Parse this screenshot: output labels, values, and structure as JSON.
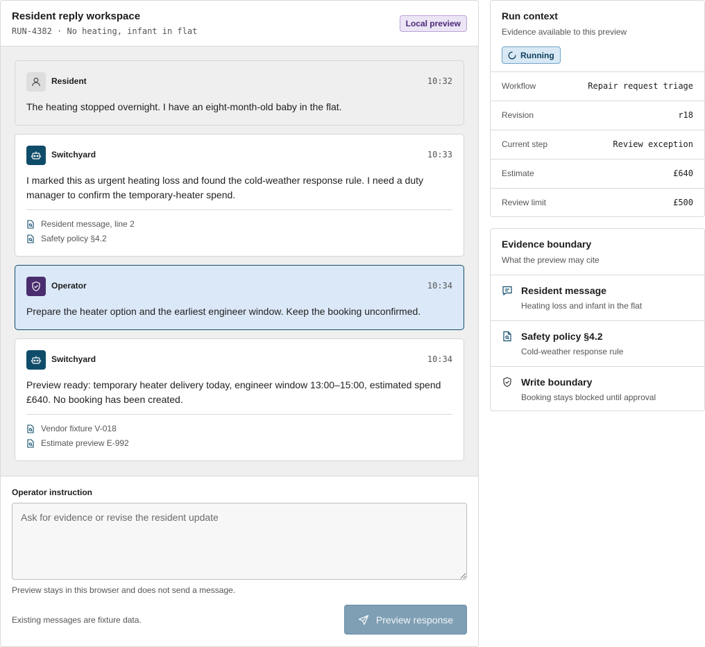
{
  "workspace": {
    "title": "Resident reply workspace",
    "subtitle": "RUN-4382 · No heating, infant in flat",
    "badge": "Local preview"
  },
  "messages": [
    {
      "author": "Resident",
      "time": "10:32",
      "avatar_icon": "person-icon",
      "text": "The heating stopped overnight. I have an eight-month-old baby in the flat.",
      "citations": []
    },
    {
      "author": "Switchyard",
      "time": "10:33",
      "avatar_icon": "bot-icon",
      "text": "I marked this as urgent heating loss and found the cold-weather response rule. I need a duty manager to confirm the temporary-heater spend.",
      "citations": [
        "Resident message, line 2",
        "Safety policy §4.2"
      ]
    },
    {
      "author": "Operator",
      "time": "10:34",
      "avatar_icon": "shield-icon",
      "text": "Prepare the heater option and the earliest engineer window. Keep the booking unconfirmed.",
      "citations": []
    },
    {
      "author": "Switchyard",
      "time": "10:34",
      "avatar_icon": "bot-icon",
      "text": "Preview ready: temporary heater delivery today, engineer window 13:00–15:00, estimated spend £640. No booking has been created.",
      "citations": [
        "Vendor fixture V-018",
        "Estimate preview E-992"
      ]
    }
  ],
  "composer": {
    "label": "Operator instruction",
    "placeholder": "Ask for evidence or revise the resident update",
    "value": "",
    "hint": "Preview stays in this browser and does not send a message.",
    "footer_note": "Existing messages are fixture data.",
    "send_label": "Preview response"
  },
  "run_context": {
    "title": "Run context",
    "subtitle": "Evidence available to this preview",
    "status": "Running",
    "rows": [
      {
        "key": "Workflow",
        "value": "Repair request triage"
      },
      {
        "key": "Revision",
        "value": "r18"
      },
      {
        "key": "Current step",
        "value": "Review exception"
      },
      {
        "key": "Estimate",
        "value": "£640"
      },
      {
        "key": "Review limit",
        "value": "£500"
      }
    ]
  },
  "evidence": {
    "title": "Evidence boundary",
    "subtitle": "What the preview may cite",
    "items": [
      {
        "icon": "message-icon",
        "title": "Resident message",
        "desc": "Heating loss and infant in the flat"
      },
      {
        "icon": "document-icon",
        "title": "Safety policy §4.2",
        "desc": "Cold-weather response rule"
      },
      {
        "icon": "shield-icon",
        "title": "Write boundary",
        "desc": "Booking stays blocked until approval"
      }
    ]
  },
  "colors": {
    "brand_dark": "#0f4c6a",
    "operator_bg": "#dbe8f8",
    "operator_avatar": "#4a2d6e",
    "badge_purple_bg": "#ece5f6",
    "status_blue_bg": "#d8e9f5",
    "send_button": "#7f9fb4"
  }
}
